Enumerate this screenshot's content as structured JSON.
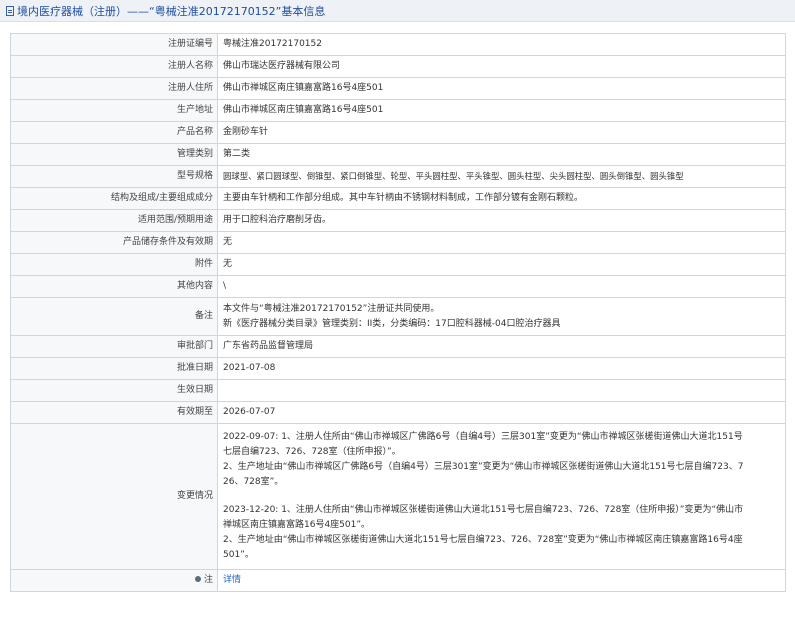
{
  "header": {
    "prefix": "境内医疗器械（注册）",
    "dash": "——",
    "title": "“粤械注准20172170152”",
    "suffix": "基本信息",
    "icon": "document-icon"
  },
  "rows": [
    {
      "label": "注册证编号",
      "value": "粤械注准20172170152"
    },
    {
      "label": "注册人名称",
      "value": "佛山市瑞达医疗器械有限公司"
    },
    {
      "label": "注册人住所",
      "value": "佛山市禅城区南庄镇嘉富路16号4座501"
    },
    {
      "label": "生产地址",
      "value": "佛山市禅城区南庄镇嘉富路16号4座501"
    },
    {
      "label": "产品名称",
      "value": "金刚砂车针"
    },
    {
      "label": "管理类别",
      "value": "第二类"
    },
    {
      "label": "型号规格",
      "value": "圆球型、紧口圆球型、倒锥型、紧口倒锥型、轮型、平头圆柱型、平头锥型、圆头柱型、尖头圆柱型、圆头倒锥型、圆头锥型"
    },
    {
      "label": "结构及组成/主要组成成分",
      "value": "主要由车针柄和工作部分组成。其中车针柄由不锈钢材料制成，工作部分镀有金刚石颗粒。"
    },
    {
      "label": "适用范围/预期用途",
      "value": "用于口腔科治疗磨削牙齿。"
    },
    {
      "label": "产品储存条件及有效期",
      "value": "无"
    },
    {
      "label": "附件",
      "value": "无"
    },
    {
      "label": "其他内容",
      "value": "\\"
    }
  ],
  "remark": {
    "label": "备注",
    "line1": "本文件与“粤械注准20172170152”注册证共同使用。",
    "line2": "新《医疗器械分类目录》管理类别：II类，分类编码：17口腔科器械-04口腔治疗器具"
  },
  "rows2": [
    {
      "label": "审批部门",
      "value": "广东省药品监督管理局"
    },
    {
      "label": "批准日期",
      "value": "2021-07-08"
    },
    {
      "label": "生效日期",
      "value": ""
    },
    {
      "label": "有效期至",
      "value": "2026-07-07"
    }
  ],
  "changes": {
    "label": "变更情况",
    "block1": [
      "2022-09-07: 1、注册人住所由“佛山市禅城区广佛路6号（自编4号）三层301室”变更为“佛山市禅城区张槎街道佛山大道北151号",
      "七层自编723、726、728室（住所申报）”。",
      "2、生产地址由“佛山市禅城区广佛路6号（自编4号）三层301室”变更为“佛山市禅城区张槎街道佛山大道北151号七层自编723、7",
      "26、728室”。"
    ],
    "block2": [
      "2023-12-20: 1、注册人住所由“佛山市禅城区张槎街道佛山大道北151号七层自编723、726、728室（住所申报）”变更为“佛山市",
      "禅城区南庄镇嘉富路16号4座501”。",
      "2、生产地址由“佛山市禅城区张槎街道佛山大道北151号七层自编723、726、728室”变更为“佛山市禅城区南庄镇嘉富路16号4座",
      "501”。"
    ]
  },
  "note": {
    "label": "注",
    "link": "详情",
    "icon": "pin-icon"
  },
  "colors": {
    "header_bg": "#eef1f6",
    "header_text": "#1f4e9c",
    "border": "#cfd6e0",
    "link": "#1f63c8"
  }
}
